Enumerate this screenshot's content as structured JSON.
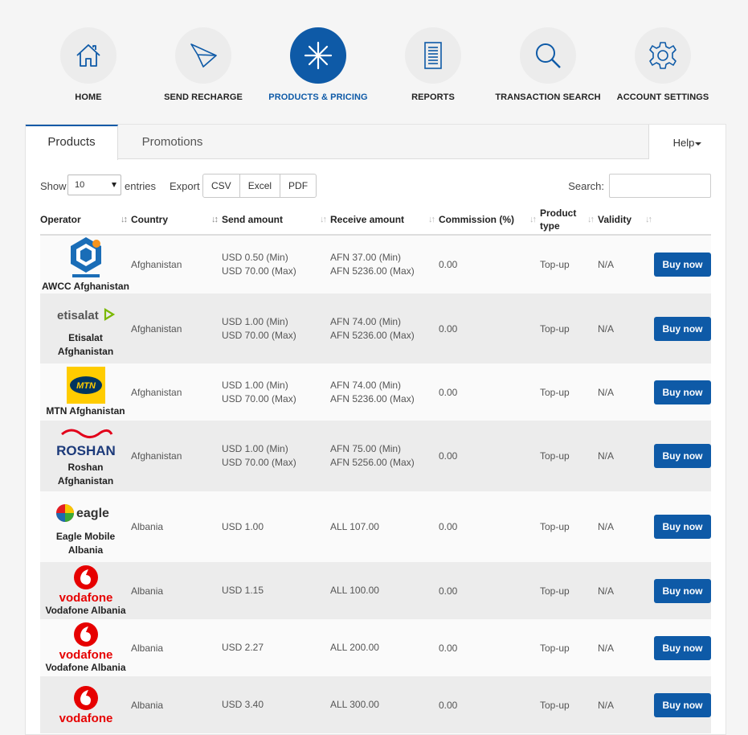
{
  "nav": [
    {
      "label": "HOME",
      "icon": "home-icon"
    },
    {
      "label": "SEND RECHARGE",
      "icon": "paper-plane-icon"
    },
    {
      "label": "PRODUCTS & PRICING",
      "icon": "asterisk-icon",
      "active": true
    },
    {
      "label": "REPORTS",
      "icon": "document-icon"
    },
    {
      "label": "TRANSACTION SEARCH",
      "icon": "search-icon"
    },
    {
      "label": "ACCOUNT SETTINGS",
      "icon": "gear-icon"
    }
  ],
  "tabs": {
    "products": "Products",
    "promotions": "Promotions",
    "help": "Help"
  },
  "controls": {
    "show": "Show",
    "entries_value": "10",
    "entries": "entries",
    "export": "Export",
    "csv": "CSV",
    "excel": "Excel",
    "pdf": "PDF",
    "search": "Search:",
    "search_value": ""
  },
  "columns": {
    "operator": "Operator",
    "country": "Country",
    "send": "Send amount",
    "receive": "Receive amount",
    "commission": "Commission (%)",
    "product_type_1": "Product",
    "product_type_2": "type",
    "validity": "Validity"
  },
  "buy_label": "Buy now",
  "colors": {
    "accent": "#0e5aa7",
    "vodafone": "#e60000",
    "mtn": "#ffcc00"
  },
  "rows": [
    {
      "operator": "AWCC Afghanistan",
      "logo": "awcc-logo",
      "country": "Afghanistan",
      "send_1": "USD 0.50 (Min)",
      "send_2": "USD 70.00 (Max)",
      "recv_1": "AFN 37.00 (Min)",
      "recv_2": "AFN 5236.00 (Max)",
      "commission": "0.00",
      "type": "Top-up",
      "validity": "N/A"
    },
    {
      "operator": "Etisalat Afghanistan",
      "logo": "etisalat-logo",
      "logo_text": "etisalat",
      "country": "Afghanistan",
      "send_1": "USD 1.00 (Min)",
      "send_2": "USD 70.00 (Max)",
      "recv_1": "AFN 74.00 (Min)",
      "recv_2": "AFN 5236.00 (Max)",
      "commission": "0.00",
      "type": "Top-up",
      "validity": "N/A"
    },
    {
      "operator": "MTN Afghanistan",
      "logo": "mtn-logo",
      "logo_text": "MTN",
      "country": "Afghanistan",
      "send_1": "USD 1.00 (Min)",
      "send_2": "USD 70.00 (Max)",
      "recv_1": "AFN 74.00 (Min)",
      "recv_2": "AFN 5236.00 (Max)",
      "commission": "0.00",
      "type": "Top-up",
      "validity": "N/A"
    },
    {
      "operator": "Roshan Afghanistan",
      "logo": "roshan-logo",
      "logo_text": "ROSHAN",
      "country": "Afghanistan",
      "send_1": "USD 1.00 (Min)",
      "send_2": "USD 70.00 (Max)",
      "recv_1": "AFN 75.00 (Min)",
      "recv_2": "AFN 5256.00 (Max)",
      "commission": "0.00",
      "type": "Top-up",
      "validity": "N/A"
    },
    {
      "operator": "Eagle Mobile Albania",
      "logo": "eagle-logo",
      "logo_text": "eagle",
      "country": "Albania",
      "send_1": "USD 1.00",
      "send_2": "",
      "recv_1": "ALL 107.00",
      "recv_2": "",
      "commission": "0.00",
      "type": "Top-up",
      "validity": "N/A"
    },
    {
      "operator": "Vodafone Albania",
      "logo": "vodafone-logo",
      "logo_text": "vodafone",
      "country": "Albania",
      "send_1": "USD 1.15",
      "send_2": "",
      "recv_1": "ALL 100.00",
      "recv_2": "",
      "commission": "0.00",
      "type": "Top-up",
      "validity": "N/A"
    },
    {
      "operator": "Vodafone Albania",
      "logo": "vodafone-logo",
      "logo_text": "vodafone",
      "country": "Albania",
      "send_1": "USD 2.27",
      "send_2": "",
      "recv_1": "ALL 200.00",
      "recv_2": "",
      "commission": "0.00",
      "type": "Top-up",
      "validity": "N/A"
    },
    {
      "operator": "",
      "logo": "vodafone-logo",
      "logo_text": "vodafone",
      "country": "Albania",
      "send_1": "USD 3.40",
      "send_2": "",
      "recv_1": "ALL 300.00",
      "recv_2": "",
      "commission": "0.00",
      "type": "Top-up",
      "validity": "N/A"
    }
  ]
}
